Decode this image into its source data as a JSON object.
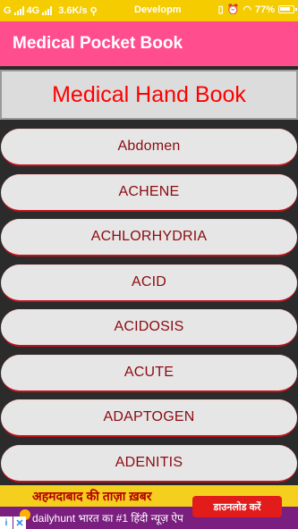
{
  "status_bar": {
    "left_text": "G",
    "network": "4G",
    "speed": "3.6K/s",
    "carrier": "Developm",
    "battery": "77%"
  },
  "app_bar": {
    "title": "Medical Pocket Book"
  },
  "header": {
    "title": "Medical Hand Book"
  },
  "items": [
    {
      "label": "Abdomen"
    },
    {
      "label": "ACHENE"
    },
    {
      "label": "ACHLORHYDRIA"
    },
    {
      "label": "ACID"
    },
    {
      "label": "ACIDOSIS"
    },
    {
      "label": "ACUTE"
    },
    {
      "label": "ADAPTOGEN"
    },
    {
      "label": "ADENITIS"
    }
  ],
  "ad": {
    "headline": "अहमदाबाद की ताज़ा ख़बर",
    "subline": "dailyhunt भारत का #1 हिंदी न्यूज़ ऐप",
    "cta": "डाउनलोड करें",
    "info_icon": "info-icon",
    "close_icon": "close-icon"
  },
  "colors": {
    "status_bar": "#f5cc00",
    "app_bar": "#ff4d8d",
    "header_text": "#ff0000",
    "item_text": "#8b0b10",
    "item_border": "#c2121c"
  }
}
